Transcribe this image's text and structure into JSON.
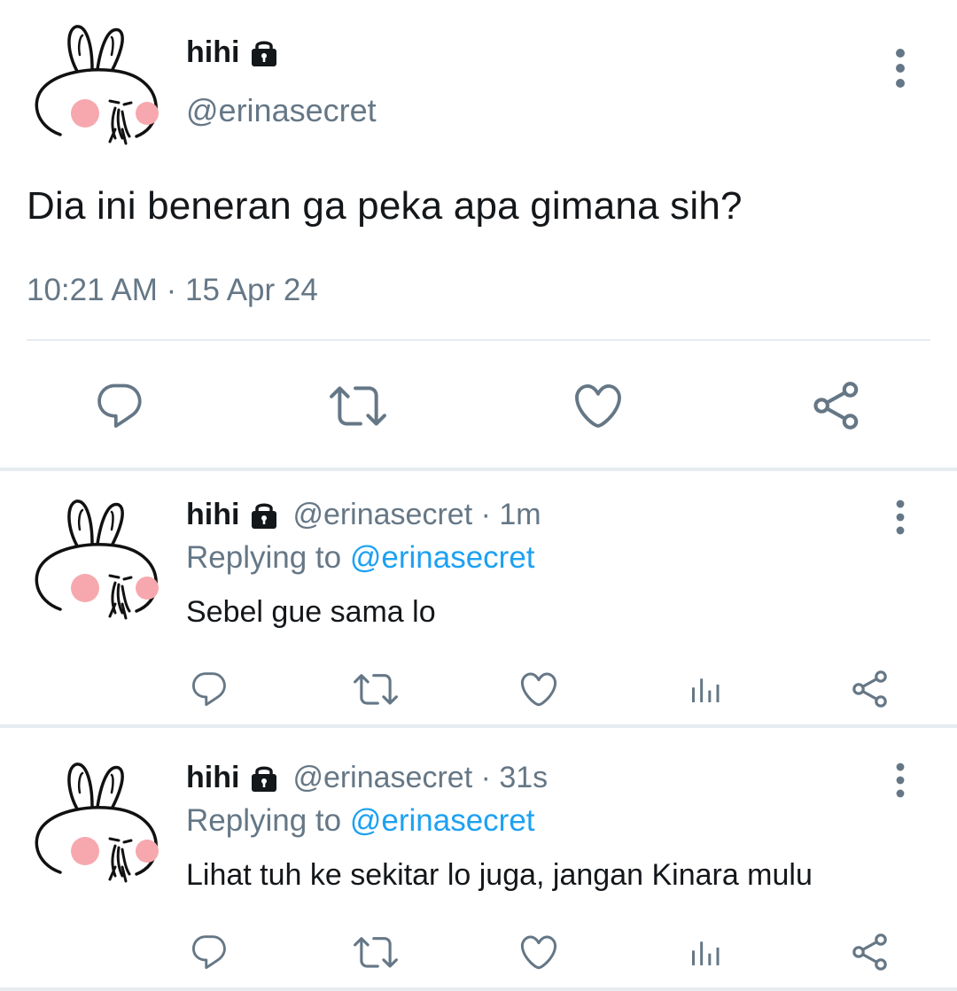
{
  "main_tweet": {
    "display_name": "hihi",
    "handle": "@erinasecret",
    "text": "Dia ini beneran ga peka apa gimana sih?",
    "timestamp": "10:21 AM · 15 Apr 24",
    "protected": true
  },
  "replies": [
    {
      "display_name": "hihi",
      "meta": "@erinasecret · 1m",
      "replying_prefix": "Replying to",
      "replying_mention": "@erinasecret",
      "text": "Sebel gue sama lo"
    },
    {
      "display_name": "hihi",
      "meta": "@erinasecret · 31s",
      "replying_prefix": "Replying to",
      "replying_mention": "@erinasecret",
      "text": "Lihat tuh ke sekitar lo juga, jangan Kinara mulu"
    }
  ],
  "icons": {
    "main_actions": [
      "reply-icon",
      "retweet-icon",
      "like-icon",
      "share-icon"
    ],
    "reply_actions": [
      "reply-icon",
      "retweet-icon",
      "like-icon",
      "analytics-icon",
      "share-icon"
    ],
    "lock": "lock-icon",
    "more": "more-vertical-icon"
  },
  "colors": {
    "text_primary": "#14171a",
    "text_secondary": "#657786",
    "mention": "#1da1f2",
    "icon": "#657786",
    "divider": "#e6ecf0",
    "avatar_blush": "#f7a8ae"
  }
}
